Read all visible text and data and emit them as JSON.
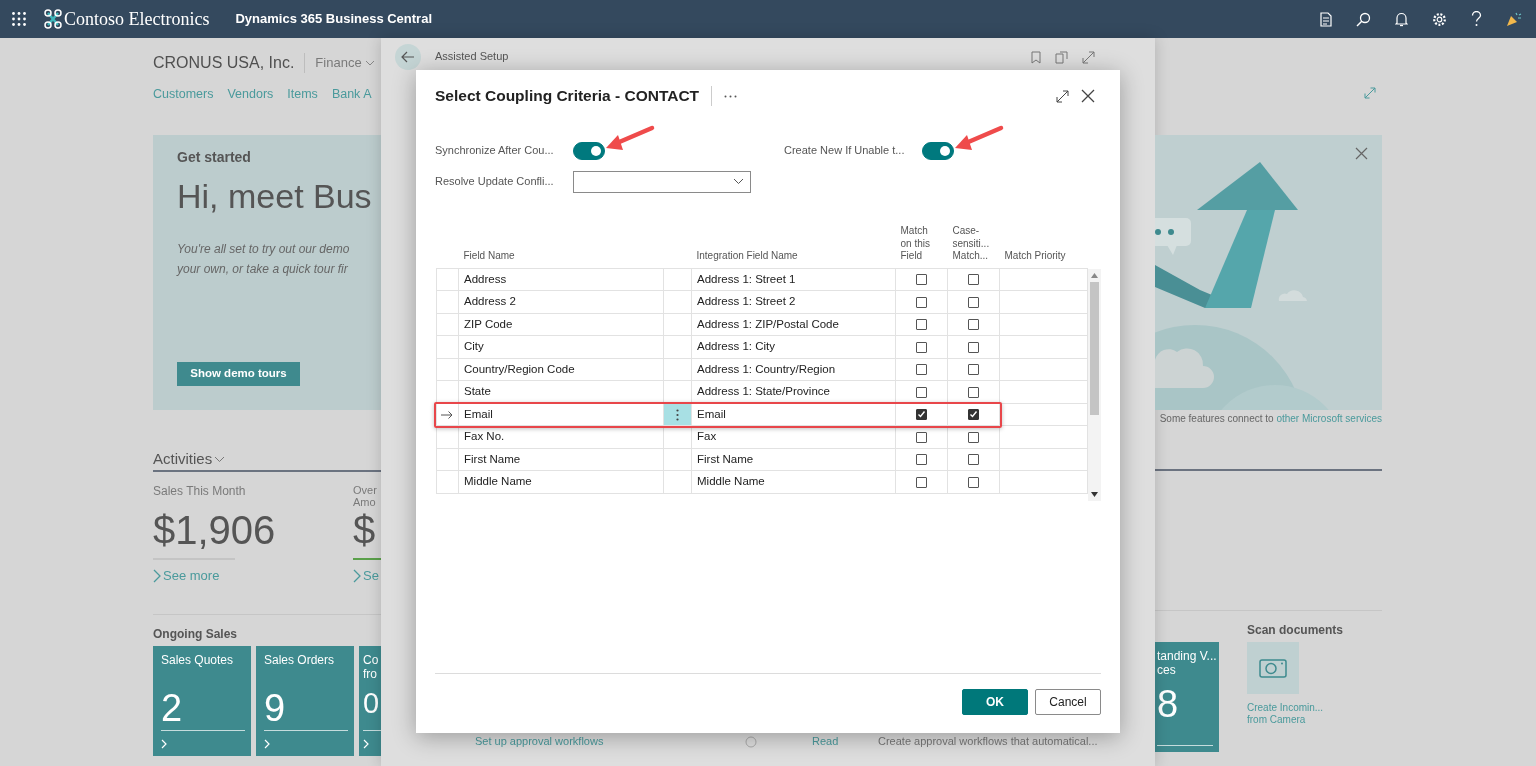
{
  "top_bar": {
    "company": "Contoso Electronics",
    "product": "Dynamics 365 Business Central"
  },
  "company_header": {
    "name": "CRONUS USA, Inc.",
    "role_center": "Finance"
  },
  "nav_links": [
    "Customers",
    "Vendors",
    "Items",
    "Bank A"
  ],
  "banner": {
    "heading": "Get started",
    "title": "Hi, meet Bus",
    "lines": [
      "You're all set to try out our demo",
      "your own, or take a quick tour fir"
    ],
    "button": "Show demo tours",
    "footnote": "Some features connect to",
    "footnote_link": "other Microsoft services"
  },
  "activities": {
    "title": "Activities",
    "cues": [
      {
        "label_lines": [
          "Sales This Month"
        ],
        "value": "$1,906",
        "link": "See more",
        "color": "#c4c4c4"
      },
      {
        "label_lines": [
          "Over",
          "Amo"
        ],
        "value": "$",
        "link": "Se",
        "color": "#5aa04a"
      }
    ]
  },
  "ongoing_sales": {
    "title": "Ongoing Sales",
    "tiles": [
      {
        "label_lines": [
          "Sales Quotes"
        ],
        "value": "2"
      },
      {
        "label_lines": [
          "Sales Orders"
        ],
        "value": "9"
      },
      {
        "label_lines": [
          "Co",
          "fro"
        ],
        "value": "0"
      }
    ],
    "tile_right": {
      "label_lines": [
        "tanding V...",
        "ces"
      ],
      "value": "8"
    }
  },
  "scan_documents": {
    "title": "Scan documents",
    "action_lines": [
      "Create Incomin...",
      "from Camera"
    ]
  },
  "assisted_setup": {
    "title": "Assisted Setup",
    "footer_texts": [
      {
        "text": "Set up approval workflows",
        "kind": "link"
      },
      {
        "text": "Read",
        "kind": "link"
      },
      {
        "text": "Create approval workflows that automatical...",
        "kind": "text"
      }
    ]
  },
  "dialog": {
    "title": "Select Coupling Criteria - CONTACT",
    "fields": [
      {
        "label": "Synchronize After Cou...",
        "kind": "toggle",
        "on": true,
        "annotated": true
      },
      {
        "label": "Create New If Unable t...",
        "kind": "toggle",
        "on": true,
        "annotated": true
      },
      {
        "label": "Resolve Update Confli...",
        "kind": "select"
      }
    ],
    "columns": [
      "Field Name",
      "Integration Field Name",
      "Match on this Field",
      "Case-sensiti... Match...",
      "Match Priority"
    ],
    "rows": [
      {
        "field": "Address",
        "integration_field": "Address 1: Street 1",
        "match": false,
        "case_sensitive": false,
        "selected": false,
        "annotated": false
      },
      {
        "field": "Address 2",
        "integration_field": "Address 1: Street 2",
        "match": false,
        "case_sensitive": false,
        "selected": false,
        "annotated": false
      },
      {
        "field": "ZIP Code",
        "integration_field": "Address 1: ZIP/Postal Code",
        "match": false,
        "case_sensitive": false,
        "selected": false,
        "annotated": false
      },
      {
        "field": "City",
        "integration_field": "Address 1: City",
        "match": false,
        "case_sensitive": false,
        "selected": false,
        "annotated": false
      },
      {
        "field": "Country/Region Code",
        "integration_field": "Address 1: Country/Region",
        "match": false,
        "case_sensitive": false,
        "selected": false,
        "annotated": false
      },
      {
        "field": "State",
        "integration_field": "Address 1: State/Province",
        "match": false,
        "case_sensitive": false,
        "selected": false,
        "annotated": false
      },
      {
        "field": "Email",
        "integration_field": "Email",
        "match": true,
        "case_sensitive": true,
        "selected": true,
        "annotated": true
      },
      {
        "field": "Fax No.",
        "integration_field": "Fax",
        "match": false,
        "case_sensitive": false,
        "selected": false,
        "annotated": false
      },
      {
        "field": "First Name",
        "integration_field": "First Name",
        "match": false,
        "case_sensitive": false,
        "selected": false,
        "annotated": false
      },
      {
        "field": "Middle Name",
        "integration_field": "Middle Name",
        "match": false,
        "case_sensitive": false,
        "selected": false,
        "annotated": false
      }
    ],
    "buttons": [
      {
        "label": "OK",
        "kind": "primary"
      },
      {
        "label": "Cancel",
        "kind": "secondary"
      }
    ]
  }
}
